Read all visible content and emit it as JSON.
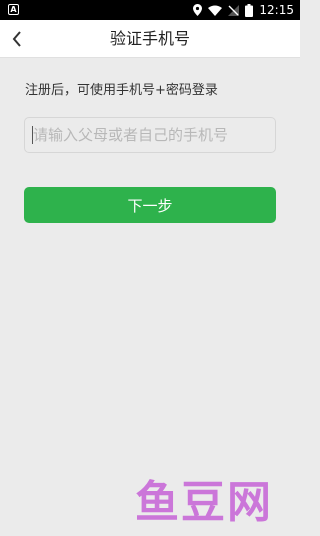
{
  "status_bar": {
    "left_icon_letter": "A",
    "time": "12:15"
  },
  "nav": {
    "title": "验证手机号",
    "back_icon": "chevron-left-icon"
  },
  "main": {
    "hint": "注册后，可使用手机号+密码登录",
    "phone_input": {
      "value": "",
      "placeholder": "请输入父母或者自己的手机号"
    },
    "next_button_label": "下一步"
  },
  "watermark": {
    "text": "鱼豆网"
  },
  "colors": {
    "background": "#ebebeb",
    "accent": "#2eb24c",
    "watermark": "#c86ad8"
  }
}
